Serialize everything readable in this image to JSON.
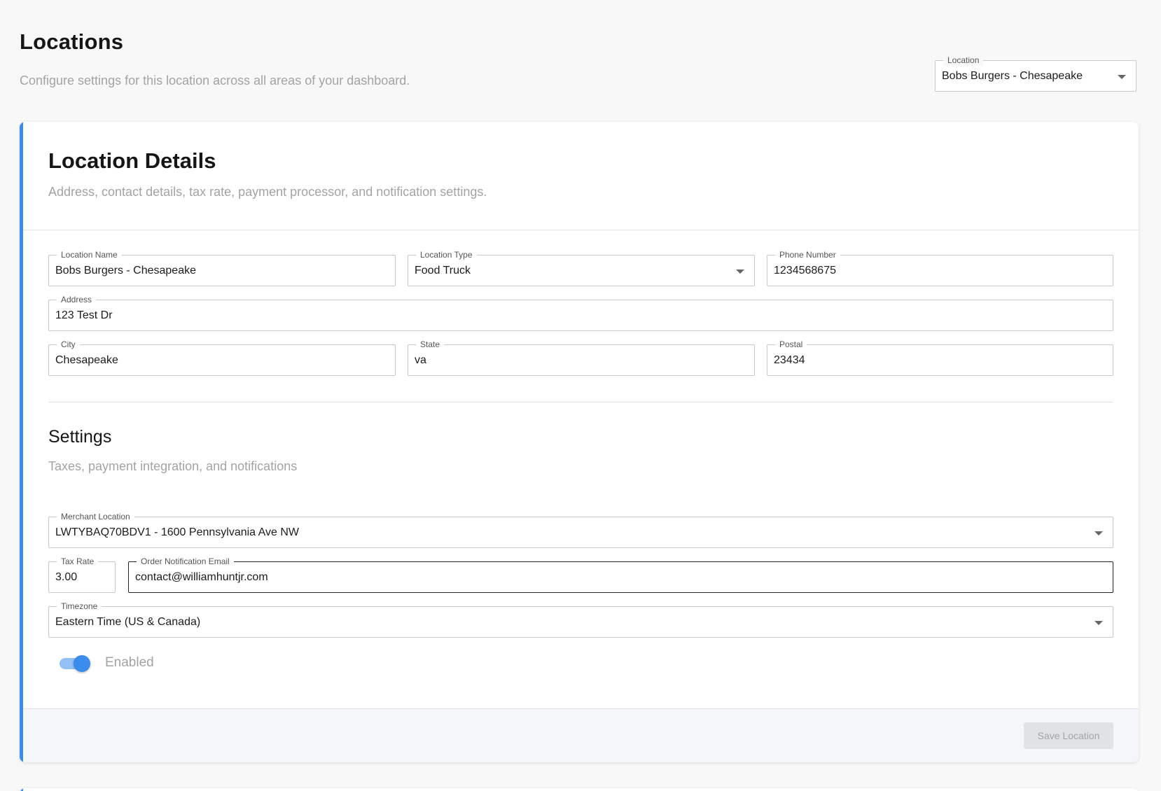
{
  "page": {
    "title": "Locations",
    "subtitle": "Configure settings for this location across all areas of your dashboard."
  },
  "location_select": {
    "label": "Location",
    "value": "Bobs Burgers - Chesapeake"
  },
  "card": {
    "title": "Location Details",
    "subtitle": "Address, contact details, tax rate, payment processor, and notification settings."
  },
  "fields": {
    "location_name": {
      "label": "Location Name",
      "value": "Bobs Burgers - Chesapeake"
    },
    "location_type": {
      "label": "Location Type",
      "value": "Food Truck"
    },
    "phone_number": {
      "label": "Phone Number",
      "value": "1234568675"
    },
    "address": {
      "label": "Address",
      "value": "123 Test Dr"
    },
    "city": {
      "label": "City",
      "value": "Chesapeake"
    },
    "state": {
      "label": "State",
      "value": "va"
    },
    "postal": {
      "label": "Postal",
      "value": "23434"
    }
  },
  "settings": {
    "title": "Settings",
    "subtitle": "Taxes, payment integration, and notifications",
    "merchant_location": {
      "label": "Merchant Location",
      "value": "LWTYBAQ70BDV1 - 1600 Pennsylvania Ave NW"
    },
    "tax_rate": {
      "label": "Tax Rate",
      "value": "3.00"
    },
    "order_email": {
      "label": "Order Notification Email",
      "value": "contact@williamhuntjr.com"
    },
    "timezone": {
      "label": "Timezone",
      "value": "Eastern Time (US & Canada)"
    },
    "enabled": {
      "label": "Enabled",
      "checked": true
    }
  },
  "footer": {
    "save_label": "Save Location"
  },
  "colors": {
    "accent": "#3b8ced",
    "toggle_track": "#93c1f5",
    "muted_text": "#a3a3a3"
  }
}
